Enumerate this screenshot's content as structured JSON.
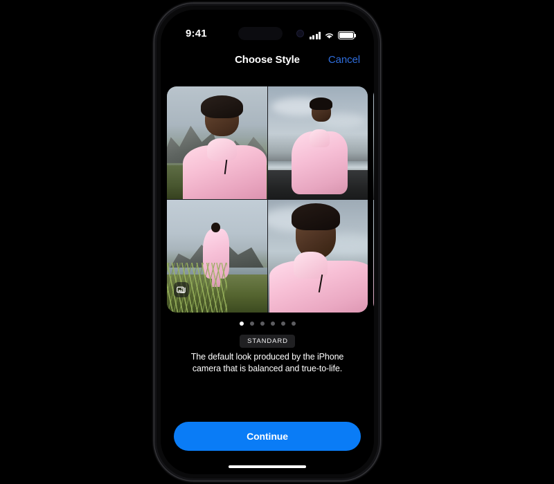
{
  "status_bar": {
    "time": "9:41",
    "signal_icon": "cellular-signal-icon",
    "wifi_icon": "wifi-icon",
    "battery_icon": "battery-full-icon",
    "dynamic_island": "dynamic-island",
    "camera_dot": "front-camera-dot"
  },
  "nav": {
    "title": "Choose Style",
    "cancel_label": "Cancel"
  },
  "carousel": {
    "photo_badge_icon": "photo-stack-icon",
    "cards": [
      {
        "name": "standard-style-preview",
        "photos": [
          "portrait-mountains-selfie",
          "black-sand-beach-standing",
          "grass-field-wide-shot",
          "closeup-portrait-clouds"
        ]
      },
      {
        "name": "next-style-preview-partial",
        "photos": [
          "ocean-cloud-crop",
          "pink-garment-crop"
        ]
      }
    ],
    "page_dots": {
      "total": 6,
      "active_index": 0
    }
  },
  "style_info": {
    "name": "STANDARD",
    "description": "The default look produced by the iPhone camera that is balanced and true-to-life."
  },
  "actions": {
    "continue_label": "Continue"
  },
  "home_indicator": "home-indicator",
  "colors": {
    "accent_blue": "#0a7cf6",
    "link_blue": "#2f6ddb",
    "background": "#000000",
    "pill_background": "#202022",
    "dot_inactive": "#5d5d61"
  }
}
